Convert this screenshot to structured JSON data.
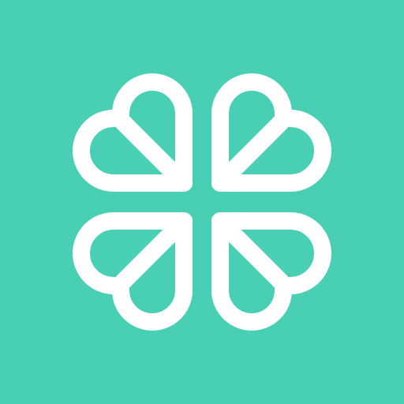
{
  "app_icon": {
    "icon": "four-leaf-clover-logo-icon",
    "background_color": "#48cfb4",
    "foreground_color": "#ffffff"
  }
}
